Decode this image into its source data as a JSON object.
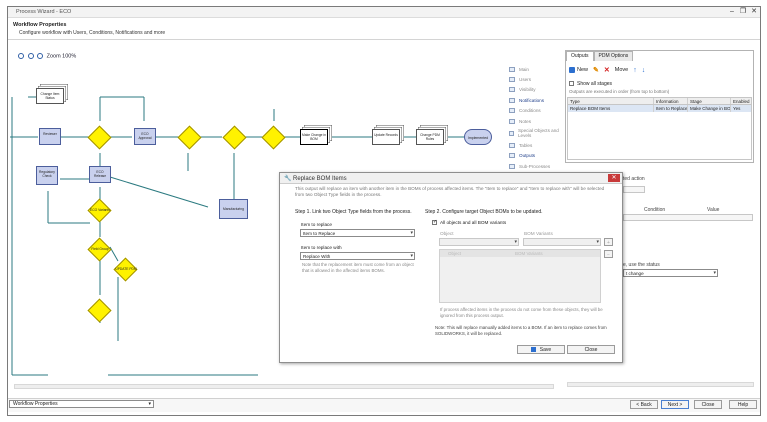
{
  "window": {
    "title": "Process Wizard - ECO",
    "minimize": "–",
    "restore": "❐",
    "close": "✕"
  },
  "header": {
    "title": "Workflow Properties",
    "subtitle": "Configure workflow with Users, Conditions, Notifications and more"
  },
  "zoom_label": "Zoom 100%",
  "diagram": {
    "nodes": {
      "change_mgmt": "Change Item Status",
      "reviewer": "Reviewer",
      "eco_approval": "ECO Approval",
      "regulatory": "Regulatory Check",
      "eco_release": "ECO Release",
      "manufacturing": "Manufacturing",
      "make_change": "Make Change in BOM",
      "update_records": "Update Records",
      "change_pdm": "Change PDM Rules",
      "implemented": "Implemented",
      "eco_variants": "ECO Variants",
      "field_group": "Field Group",
      "update_pdm": "UPDATE PDM"
    }
  },
  "props_nav": {
    "items": [
      "Main",
      "Users",
      "Visibility",
      "Notifications",
      "Conditions",
      "Notes",
      "Special Objects and Levels",
      "Tables",
      "Outputs",
      "Sub-Processes"
    ]
  },
  "outputs_panel": {
    "tabs": [
      "Outputs",
      "PDM Options"
    ],
    "toolbar": {
      "new": "New",
      "move": "Move"
    },
    "show_all_stages": "Show all stages",
    "hint": "Outputs are executed in order (from top to bottom)",
    "columns": [
      "Type",
      "Information",
      "Stage",
      "Enabled"
    ],
    "rows": [
      [
        "Replace BOM Items",
        "Item to Replace",
        "Make Change in BOM",
        "Yes"
      ]
    ]
  },
  "right_stub": {
    "action_label": "ted action",
    "condition_label": "Condition",
    "value_label": "Value",
    "status_label": "e, use the status",
    "status_select": "t change"
  },
  "dialog": {
    "title": "Replace BOM Items",
    "close": "✕",
    "description": "This output will replace an item with another item in the BOMs of process affected items. The \"Item to replace\" and \"Item to replace with\" will be selected from two Object Type fields in the process.",
    "step1": "Step 1. Link two Object Type fields from the process.",
    "item_to_replace_label": "Item to replace",
    "item_to_replace_value": "Item to Replace",
    "replace_with_label": "Item to replace with",
    "replace_with_value": "Replace With",
    "step1_note": "Note that the replacement item must come from an object that is allowed in the affected items BOMs.",
    "step2": "Step 2. Configure target Object BOMs to be updated.",
    "all_objects": "All objects and all BOM variants",
    "object_col": "Object",
    "bom_variants_col": "BOM Variants",
    "list_col1": "Object",
    "list_col2": "BOM Variants",
    "step2_note": "If process affected items in the process do not come from these objects, they will be ignored from this process output.",
    "bottom_note": "Note: This will replace manually added items to a BOM. If an item to replace comes from SOLIDWORKS, it will be replaced.",
    "save": "Save",
    "close_btn": "Close"
  },
  "footer": {
    "section_select": "Workflow Properties",
    "back": "< Back",
    "next": "Next >",
    "close": "Close",
    "help": "Help"
  }
}
